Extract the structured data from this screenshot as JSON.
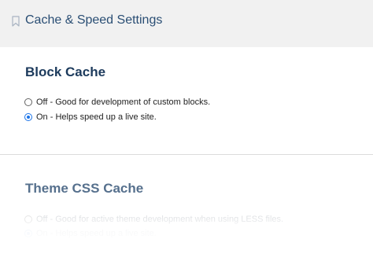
{
  "header": {
    "title": "Cache & Speed Settings",
    "icon": "bookmark-icon"
  },
  "block_cache": {
    "title": "Block Cache",
    "options": [
      {
        "label": "Off - Good for development of custom blocks.",
        "checked": false
      },
      {
        "label": "On - Helps speed up a live site.",
        "checked": true
      }
    ]
  },
  "theme_css_cache": {
    "title": "Theme CSS Cache",
    "options": [
      {
        "label": "Off - Good for active theme development when using LESS files.",
        "checked": false
      },
      {
        "label": "On - Helps speed up a live site.",
        "checked": true
      }
    ]
  },
  "colors": {
    "header_bg": "#f1f1f1",
    "title_color": "#2a4e74",
    "accent": "#1a73e8"
  }
}
